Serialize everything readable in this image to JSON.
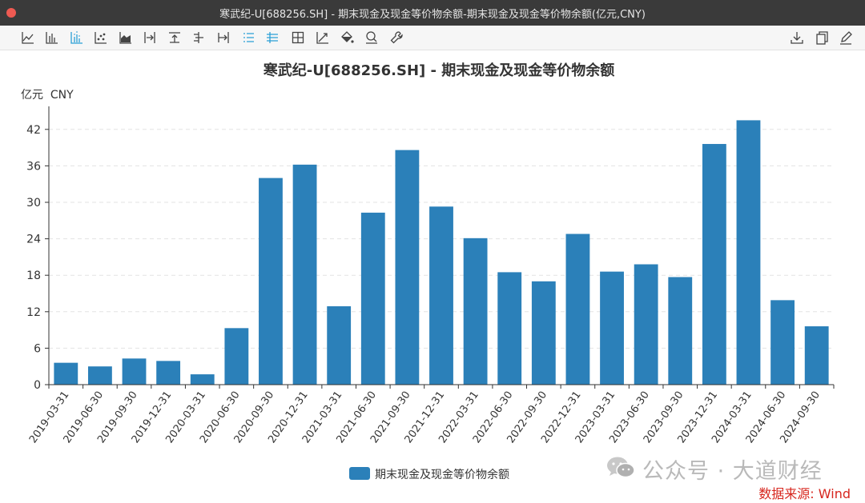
{
  "window": {
    "title": "寒武纪-U[688256.SH] - 期末现金及现金等价物余额-期末现金及现金等价物余额(亿元,CNY)"
  },
  "toolbar": {
    "left_icons": [
      "line-chart-icon",
      "bar-chart-icon",
      "bar-chart-labeled-icon",
      "scatter-chart-icon",
      "area-chart-icon",
      "axis-right-icon",
      "axis-top-icon",
      "axis-left-icon",
      "axis-align-icon",
      "list-align-icon",
      "list-indent-icon",
      "grid-icon",
      "trend-line-icon",
      "fill-color-icon",
      "zoom-icon",
      "settings-wrench-icon"
    ],
    "right_icons": [
      "download-icon",
      "copy-icon",
      "edit-icon"
    ],
    "active": [
      "bar-chart-labeled-icon",
      "list-align-icon",
      "list-indent-icon"
    ],
    "active_color": "#2a9fd6"
  },
  "watermark": {
    "text": "公众号 · 大道财经"
  },
  "source": {
    "text": "数据来源: Wind",
    "color": "#d7261e"
  },
  "chart_data": {
    "type": "bar",
    "title": "寒武纪-U[688256.SH] - 期末现金及现金等价物余额",
    "ylabel": "亿元  CNY",
    "xlabel": "",
    "categories": [
      "2019-03-31",
      "2019-06-30",
      "2019-09-30",
      "2019-12-31",
      "2020-03-31",
      "2020-06-30",
      "2020-09-30",
      "2020-12-31",
      "2021-03-31",
      "2021-06-30",
      "2021-09-30",
      "2021-12-31",
      "2022-03-31",
      "2022-06-30",
      "2022-09-30",
      "2022-12-31",
      "2023-03-31",
      "2023-06-30",
      "2023-09-30",
      "2023-12-31",
      "2024-03-31",
      "2024-06-30",
      "2024-09-30"
    ],
    "series": [
      {
        "name": "期末现金及现金等价物余额",
        "values": [
          3.6,
          3.0,
          4.3,
          3.9,
          1.7,
          9.3,
          34.0,
          36.2,
          12.9,
          28.3,
          38.6,
          29.3,
          24.1,
          18.5,
          17.0,
          24.8,
          18.6,
          19.8,
          17.7,
          39.6,
          43.5,
          13.9,
          9.6
        ]
      }
    ],
    "ylim": [
      0,
      45
    ],
    "yticks": [
      0,
      6,
      12,
      18,
      24,
      30,
      36,
      42
    ],
    "grid": true,
    "legend_position": "bottom-center",
    "bar_color": "#2b80b9"
  }
}
